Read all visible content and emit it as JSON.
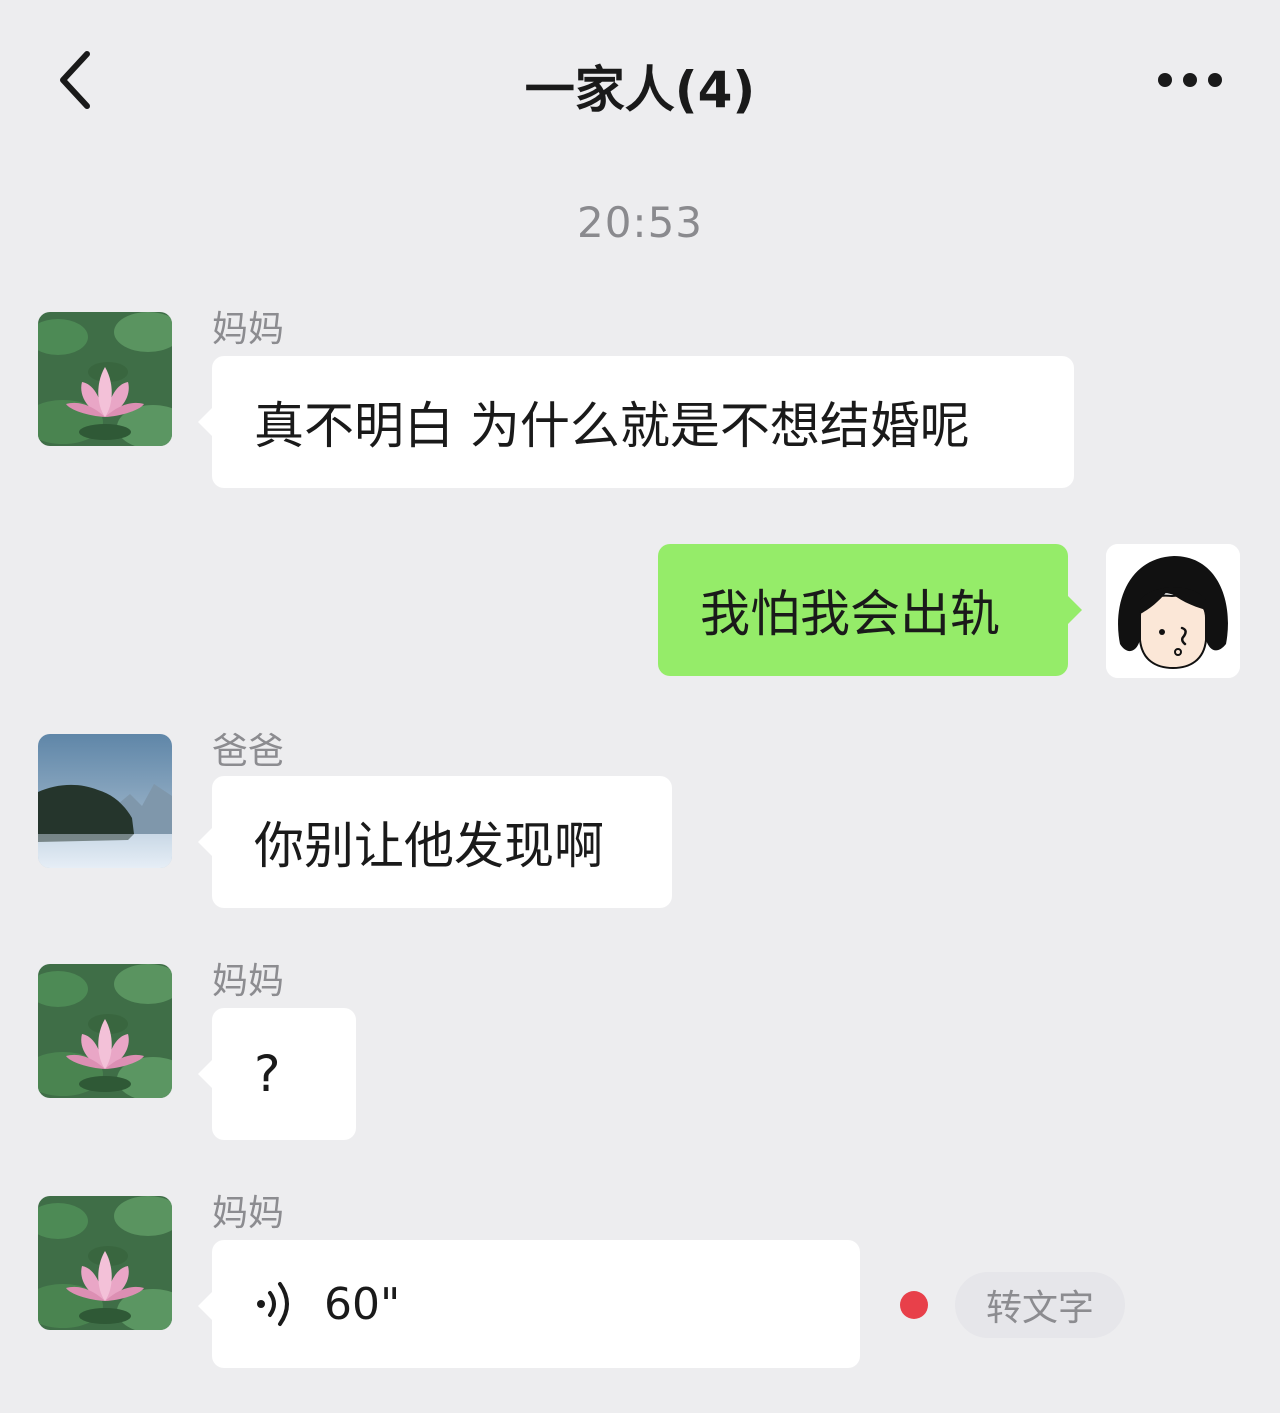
{
  "header": {
    "title": "一家人(4)",
    "back_icon": "chevron-left-icon",
    "more_icon": "more-icon"
  },
  "timestamp": "20:53",
  "messages": [
    {
      "sender": "妈妈",
      "text": "真不明白 为什么就是不想结婚呢",
      "side": "left",
      "avatar": "lotus"
    },
    {
      "sender": "",
      "text": "我怕我会出轨",
      "side": "right",
      "avatar": "cartoon-girl"
    },
    {
      "sender": "爸爸",
      "text": "你别让他发现啊",
      "side": "left",
      "avatar": "landscape"
    },
    {
      "sender": "妈妈",
      "text": "?",
      "side": "left",
      "avatar": "lotus"
    },
    {
      "sender": "妈妈",
      "type": "voice",
      "duration": "60\"",
      "side": "left",
      "avatar": "lotus",
      "unread": true,
      "transcribe_label": "转文字"
    }
  ],
  "colors": {
    "background": "#ededef",
    "bubble_left": "#ffffff",
    "bubble_right": "#95ec69",
    "unread_dot": "#e8404a"
  }
}
